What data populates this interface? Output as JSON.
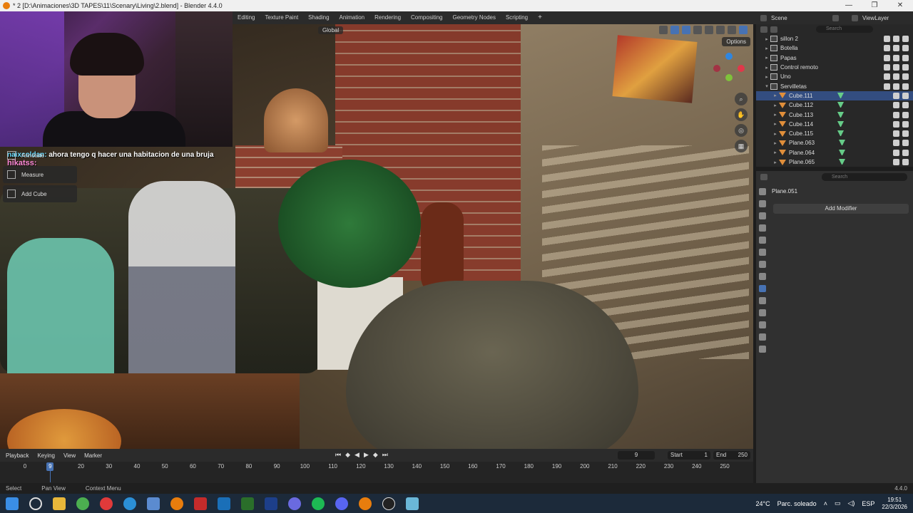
{
  "window": {
    "title": "* 2 [D:\\Animaciones\\3D TAPES\\11\\Scenary\\Living\\2.blend] - Blender 4.4.0",
    "controls": [
      "—",
      "❐",
      "✕"
    ]
  },
  "workspaces": [
    "Editing",
    "Texture Paint",
    "Shading",
    "Animation",
    "Rendering",
    "Compositing",
    "Geometry Nodes",
    "Scripting",
    "+"
  ],
  "scene": {
    "name": "Scene",
    "view_layer": "ViewLayer"
  },
  "viewport": {
    "orientation": "Global",
    "options_label": "Options"
  },
  "tools": [
    {
      "label": "Annotate"
    },
    {
      "label": "Measure"
    },
    {
      "label": "Add Cube"
    }
  ],
  "chat": {
    "user1": "naixcoldan:",
    "msg1": "ahora tengo q hacer una habitacion de una bruja",
    "user2": "hikatss:"
  },
  "outliner": {
    "search_placeholder": "Search",
    "rows": [
      {
        "label": "sillon 2",
        "kind": "collection",
        "expanded": false,
        "selected": false,
        "child": false
      },
      {
        "label": "Botella",
        "kind": "collection",
        "expanded": false,
        "selected": false,
        "child": false
      },
      {
        "label": "Papas",
        "kind": "collection",
        "expanded": false,
        "selected": false,
        "child": false
      },
      {
        "label": "Control remoto",
        "kind": "collection",
        "expanded": false,
        "selected": false,
        "child": false
      },
      {
        "label": "Uno",
        "kind": "collection",
        "expanded": false,
        "selected": false,
        "child": false
      },
      {
        "label": "Servilletas",
        "kind": "collection",
        "expanded": true,
        "selected": false,
        "child": false
      },
      {
        "label": "Cube.111",
        "kind": "mesh",
        "expanded": false,
        "selected": true,
        "child": true
      },
      {
        "label": "Cube.112",
        "kind": "mesh",
        "expanded": false,
        "selected": false,
        "child": true
      },
      {
        "label": "Cube.113",
        "kind": "mesh",
        "expanded": false,
        "selected": false,
        "child": true
      },
      {
        "label": "Cube.114",
        "kind": "mesh",
        "expanded": false,
        "selected": false,
        "child": true
      },
      {
        "label": "Cube.115",
        "kind": "mesh",
        "expanded": false,
        "selected": false,
        "child": true
      },
      {
        "label": "Plane.063",
        "kind": "mesh",
        "expanded": false,
        "selected": false,
        "child": true
      },
      {
        "label": "Plane.064",
        "kind": "mesh",
        "expanded": false,
        "selected": false,
        "child": true
      },
      {
        "label": "Plane.065",
        "kind": "mesh",
        "expanded": false,
        "selected": false,
        "child": true
      }
    ]
  },
  "properties": {
    "search_placeholder": "Search",
    "object_name": "Plane.051",
    "add_modifier": "Add Modifier"
  },
  "timeline": {
    "menus": [
      "Playback",
      "Keying",
      "View",
      "Marker"
    ],
    "current_frame": "9",
    "start_label": "Start",
    "start": "1",
    "end_label": "End",
    "end": "250",
    "ticks": [
      "0",
      "20",
      "30",
      "40",
      "50",
      "60",
      "70",
      "80",
      "90",
      "100",
      "110",
      "120",
      "130",
      "140",
      "150",
      "160",
      "170",
      "180",
      "190",
      "200",
      "210",
      "220",
      "230",
      "240",
      "250"
    ],
    "playhead": "9"
  },
  "statusbar": {
    "select": "Select",
    "pan": "Pan View",
    "context": "Context Menu",
    "version": "4.4.0"
  },
  "taskbar": {
    "weather_temp": "24°C",
    "weather_text": "Parc. soleado",
    "lang": "ESP",
    "time": "19:51",
    "date": "22/3/2026"
  }
}
